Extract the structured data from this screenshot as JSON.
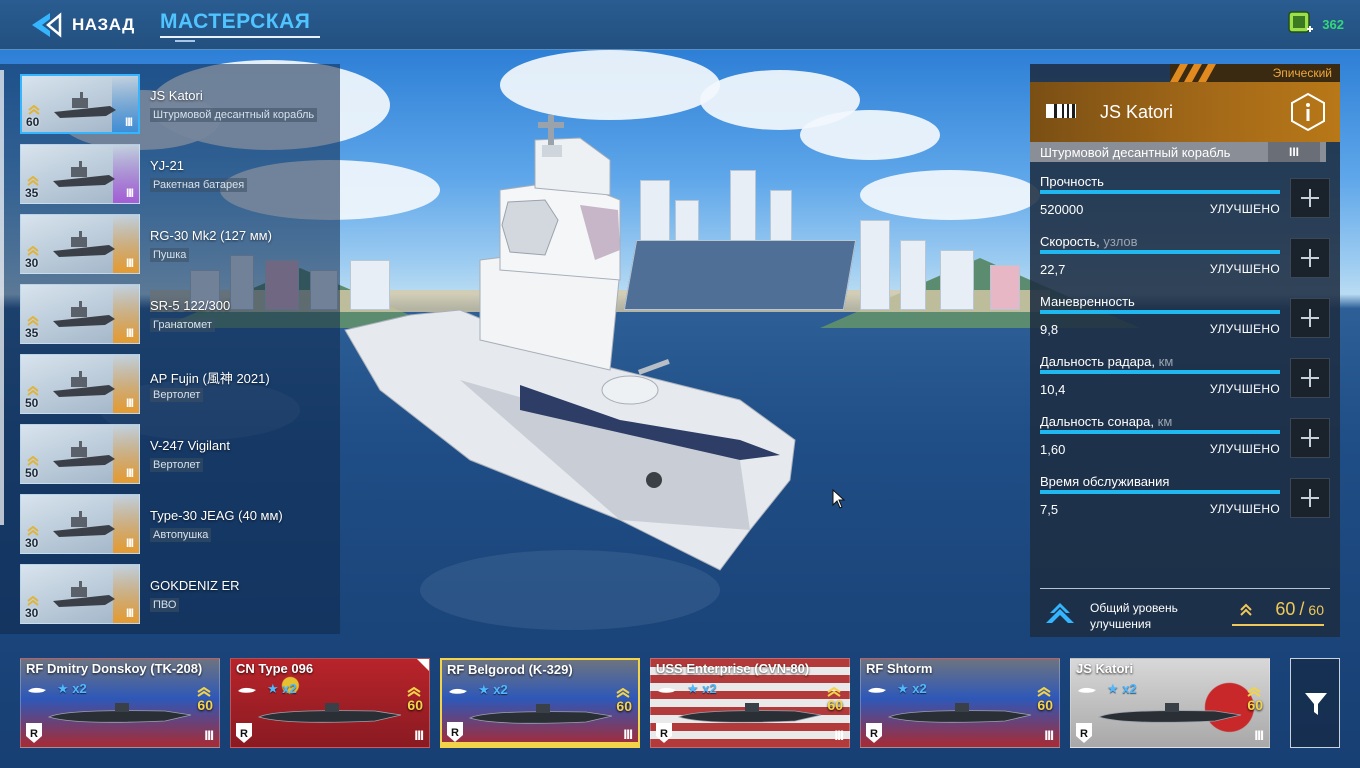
{
  "topbar": {
    "back_label": "НАЗАД",
    "title": "МАСТЕРСКАЯ",
    "currency_value": "362",
    "colors": {
      "title": "#4fc4ff",
      "currency": "#35d67a"
    }
  },
  "equipment": [
    {
      "name": "JS Katori",
      "type": "Штурмовой десантный корабль",
      "level": "60",
      "tier": "III",
      "icon": "ship-icon",
      "selected": true
    },
    {
      "name": "YJ-21",
      "type": "Ракетная батарея",
      "level": "35",
      "tier": "III",
      "icon": "missile-icon"
    },
    {
      "name": "RG-30 Mk2 (127 мм)",
      "type": "Пушка",
      "level": "30",
      "tier": "III",
      "icon": "cannon-icon"
    },
    {
      "name": "SR-5 122/300",
      "type": "Гранатомет",
      "level": "35",
      "tier": "III",
      "icon": "launcher-icon"
    },
    {
      "name": "AP Fujin (風神 2021)",
      "type": "Вертолет",
      "level": "50",
      "tier": "III",
      "icon": "helicopter-icon"
    },
    {
      "name": "V-247 Vigilant",
      "type": "Вертолет",
      "level": "50",
      "tier": "III",
      "icon": "tiltrotor-icon"
    },
    {
      "name": "Type-30 JEAG (40 мм)",
      "type": "Автопушка",
      "level": "30",
      "tier": "III",
      "icon": "autocannon-icon"
    },
    {
      "name": "GOKDENIZ ER",
      "type": "ПВО",
      "level": "30",
      "tier": "III",
      "icon": "ciws-icon"
    }
  ],
  "panel": {
    "rarity": "Эпический",
    "ship_name": "JS Katori",
    "ship_type": "Штурмовой десантный корабль",
    "tier": "III",
    "stats": [
      {
        "label": "Прочность",
        "unit": "",
        "value": "520000",
        "status": "УЛУЧШЕНО"
      },
      {
        "label": "Скорость,",
        "unit": "узлов",
        "value": "22,7",
        "status": "УЛУЧШЕНО"
      },
      {
        "label": "Маневренность",
        "unit": "",
        "value": "9,8",
        "status": "УЛУЧШЕНО"
      },
      {
        "label": "Дальность радара,",
        "unit": "км",
        "value": "10,4",
        "status": "УЛУЧШЕНО"
      },
      {
        "label": "Дальность сонара,",
        "unit": "км",
        "value": "1,60",
        "status": "УЛУЧШЕНО"
      },
      {
        "label": "Время обслуживания",
        "unit": "",
        "value": "7,5",
        "status": "УЛУЧШЕНО"
      }
    ],
    "total_label": "Общий уровень улучшения",
    "total_value": "60",
    "total_sep": "/",
    "total_max": "60",
    "colors": {
      "bar": "#20b8f0",
      "gold": "#f0c85a",
      "rarity": "#f0a73a"
    }
  },
  "fleet": [
    {
      "name": "RF Dmitry Donskoy (TK-208)",
      "stars": "x2",
      "level": "60",
      "tier": "III",
      "class_icon": "submarine-class-icon",
      "flag": "russia"
    },
    {
      "name": "CN Type 096",
      "stars": "x2",
      "level": "60",
      "tier": "III",
      "class_icon": "submarine-class-icon",
      "flag": "china"
    },
    {
      "name": "RF Belgorod (K-329)",
      "stars": "x2",
      "level": "60",
      "tier": "III",
      "class_icon": "submarine-class-icon",
      "flag": "russia",
      "selected": true
    },
    {
      "name": "USS Enterprise (CVN-80)",
      "stars": "x2",
      "level": "60",
      "tier": "III",
      "class_icon": "carrier-class-icon",
      "flag": "usa"
    },
    {
      "name": "RF Shtorm",
      "stars": "x2",
      "level": "60",
      "tier": "III",
      "class_icon": "carrier-class-icon",
      "flag": "russia"
    },
    {
      "name": "JS Katori",
      "stars": "x2",
      "level": "60",
      "tier": "III",
      "class_icon": "assault-class-icon",
      "flag": "japan"
    }
  ]
}
